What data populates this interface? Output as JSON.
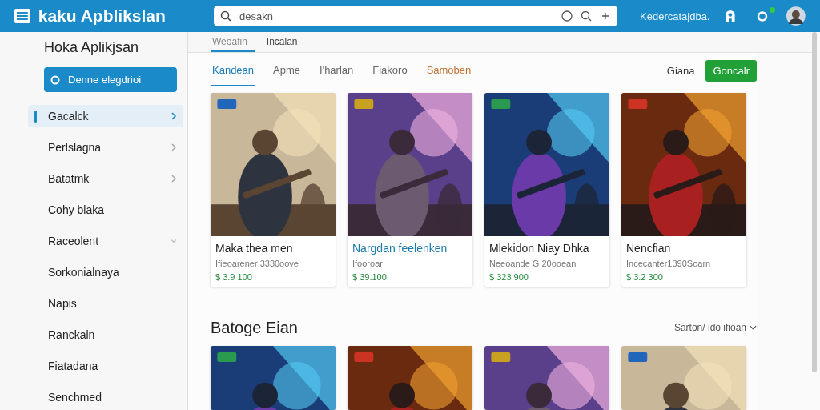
{
  "header": {
    "title": "kaku Apblikslan",
    "search": {
      "value": "desakn"
    },
    "account_label": "Kedercatajdba.",
    "notification": true
  },
  "sidebar": {
    "title": "Hoka Aplikjsan",
    "primary_button": "Denne elegdrioi",
    "items": [
      {
        "label": "Gacalck",
        "selected": true,
        "expandable": true,
        "expanded": false
      },
      {
        "label": "Perlslagna",
        "selected": false,
        "expandable": true,
        "expanded": false
      },
      {
        "label": "Batatmk",
        "selected": false,
        "expandable": true,
        "expanded": false
      },
      {
        "label": "Cohy blaka",
        "selected": false,
        "expandable": false,
        "expanded": false
      },
      {
        "label": "Raceolent",
        "selected": false,
        "expandable": true,
        "expanded": true
      },
      {
        "label": "Sorkonialnaya",
        "selected": false,
        "expandable": false,
        "expanded": false
      },
      {
        "label": "Napis",
        "selected": false,
        "expandable": false,
        "expanded": false
      },
      {
        "label": "Ranckaln",
        "selected": false,
        "expandable": false,
        "expanded": false
      },
      {
        "label": "Fiatadana",
        "selected": false,
        "expandable": false,
        "expanded": false
      },
      {
        "label": "Senchmed",
        "selected": false,
        "expandable": false,
        "expanded": false
      }
    ]
  },
  "top_tabs": [
    {
      "label": "Weoafin",
      "selected": true
    },
    {
      "label": "Incalan",
      "selected": false
    }
  ],
  "category_tabs": [
    {
      "label": "Kandean",
      "selected": true,
      "accent": false
    },
    {
      "label": "Apme",
      "selected": false,
      "accent": false
    },
    {
      "label": "I'harlan",
      "selected": false,
      "accent": false
    },
    {
      "label": "Fiakoro",
      "selected": false,
      "accent": false
    },
    {
      "label": "Samoben",
      "selected": false,
      "accent": true
    }
  ],
  "toolbar": {
    "link": "Giana",
    "button": "Goncalr"
  },
  "apps": [
    {
      "title": "Maka thea men",
      "subtitle": "Ifieoarener 3330oove",
      "price": "$ 3.9 100",
      "highlighted": false
    },
    {
      "title": "Nargdan feelenken",
      "subtitle": "Ifooroar",
      "price": "$ 39.100",
      "highlighted": true
    },
    {
      "title": "Mlekidon Niay Dhka",
      "subtitle": "Neeoande G 20ooean",
      "price": "$ 323 900",
      "highlighted": false
    },
    {
      "title": "Nencfian",
      "subtitle": "Incecanter1390Soarn",
      "price": "$ 3.2 300",
      "highlighted": false
    }
  ],
  "section": {
    "title": "Batoge Eian",
    "sort": "Sarton/ ido ifioan"
  }
}
